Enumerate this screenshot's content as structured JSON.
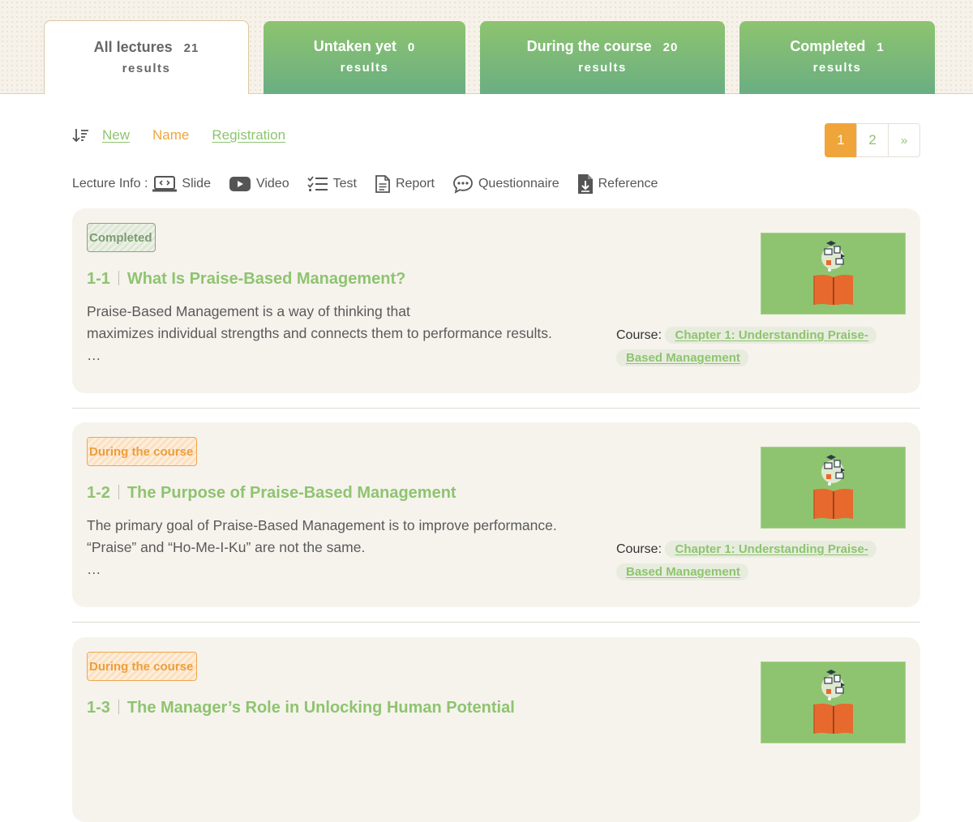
{
  "tabs": [
    {
      "label": "All lectures",
      "count": "21",
      "sub": "results"
    },
    {
      "label": "Untaken yet",
      "count": "0",
      "sub": "results"
    },
    {
      "label": "During the course",
      "count": "20",
      "sub": "results"
    },
    {
      "label": "Completed",
      "count": "1",
      "sub": "results"
    }
  ],
  "sort": {
    "icon": "sort-descending-icon",
    "new": "New",
    "name": "Name",
    "registration": "Registration"
  },
  "pagination": {
    "pages": [
      "1",
      "2"
    ],
    "next": "»",
    "current": "1"
  },
  "legend": {
    "label": "Lecture Info :",
    "items": [
      {
        "icon": "slide-icon",
        "label": "Slide"
      },
      {
        "icon": "video-icon",
        "label": "Video"
      },
      {
        "icon": "test-icon",
        "label": "Test"
      },
      {
        "icon": "report-icon",
        "label": "Report"
      },
      {
        "icon": "questionnaire-icon",
        "label": "Questionnaire"
      },
      {
        "icon": "reference-icon",
        "label": "Reference"
      }
    ]
  },
  "lectures": [
    {
      "status": "Completed",
      "number": "1-1",
      "title": "What Is Praise-Based Management?",
      "desc1": "Praise-Based Management is a way of thinking that",
      "desc2": "maximizes individual strengths and connects them to performance results.",
      "ellipsis": "…",
      "course_label": "Course:",
      "course": "Chapter 1: Understanding Praise-Based Management"
    },
    {
      "status": "During the course",
      "number": "1-2",
      "title": "The Purpose of Praise-Based Management",
      "desc1": "The primary goal of Praise-Based Management is to improve performance.",
      "desc2": "“Praise” and “Ho-Me-I-Ku” are not the same.",
      "ellipsis": "…",
      "course_label": "Course:",
      "course": "Chapter 1: Understanding Praise-Based Management"
    },
    {
      "status": "During the course",
      "number": "1-3",
      "title": "The Manager’s Role in Unlocking Human Potential"
    }
  ],
  "colors": {
    "green": "#8ec46f",
    "orange": "#f0a53a",
    "card_bg": "#f6f3ed",
    "book": "#e8692e"
  }
}
